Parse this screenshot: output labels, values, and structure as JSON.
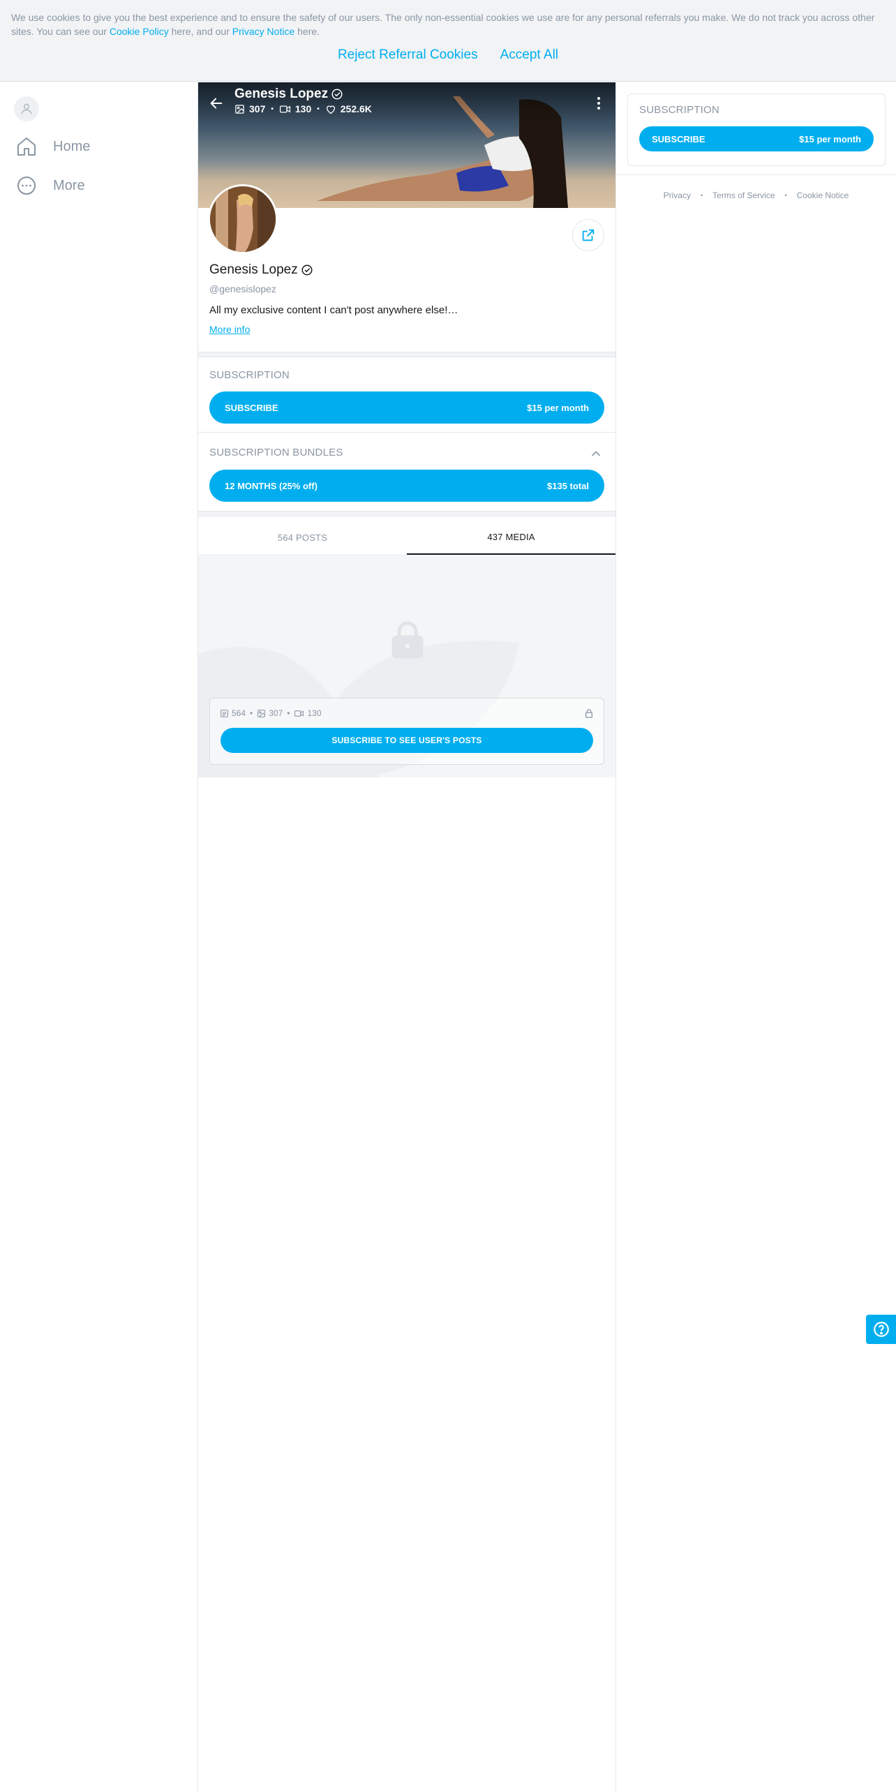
{
  "cookie_banner": {
    "text_part1": "We use cookies to give you the best experience and to ensure the safety of our users. The only non-essential cookies we use are for any personal referrals you make. We do not track you across other sites. You can see our ",
    "cookie_policy_link": "Cookie Policy",
    "text_part2": " here, and our ",
    "privacy_notice_link": "Privacy Notice",
    "text_part3": " here.",
    "reject_label": "Reject Referral Cookies",
    "accept_label": "Accept All"
  },
  "left_nav": {
    "avatar_icon": "user-icon",
    "items": [
      {
        "label": "Home",
        "icon": "home-icon"
      },
      {
        "label": "More",
        "icon": "more-circle-icon"
      }
    ]
  },
  "profile": {
    "name": "Genesis Lopez",
    "handle": "@genesislopez",
    "bio": "All my exclusive content I can't post anywhere else!…",
    "more_info": "More info",
    "stats": {
      "photos": "307",
      "videos": "130",
      "likes": "252.6K"
    },
    "verified_icon": "verified-check-icon"
  },
  "subscription": {
    "title": "SUBSCRIPTION",
    "button_label": "SUBSCRIBE",
    "price": "$15 per month"
  },
  "bundles": {
    "title": "SUBSCRIPTION BUNDLES",
    "items": [
      {
        "label": "12 MONTHS (25% off)",
        "price": "$135 total"
      }
    ]
  },
  "tabs": [
    {
      "label": "564 POSTS",
      "active": false
    },
    {
      "label": "437 MEDIA",
      "active": true
    }
  ],
  "locked": {
    "posts": "564",
    "photos": "307",
    "videos": "130",
    "button_label": "SUBSCRIBE TO SEE USER'S POSTS"
  },
  "sidebar_right": {
    "title": "SUBSCRIPTION",
    "button_label": "SUBSCRIBE",
    "price": "$15 per month",
    "footer": [
      "Privacy",
      "Terms of Service",
      "Cookie Notice"
    ]
  },
  "colors": {
    "accent": "#00aeef",
    "muted_text": "#8a96a3",
    "banner_bg": "#f1f3f5"
  }
}
